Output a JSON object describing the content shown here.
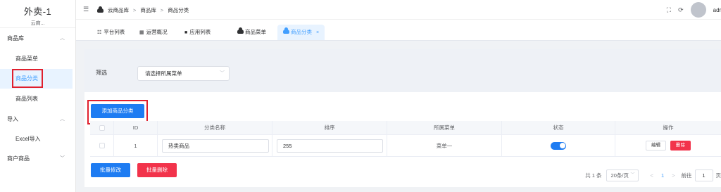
{
  "sidebar": {
    "brand_title": "外卖-1",
    "brand_sub": "云商...",
    "groups": [
      {
        "label": "商品库",
        "items": [
          "商品菜单",
          "商品分类",
          "商品列表"
        ]
      },
      {
        "label": "导入",
        "items": [
          "Excel导入"
        ]
      },
      {
        "label": "商户商品",
        "items": []
      }
    ],
    "active_item": "商品分类"
  },
  "header": {
    "breadcrumb": [
      "云商品库",
      "商品库",
      "商品分类"
    ],
    "breadcrumb_sep": ">",
    "user": "admi"
  },
  "tabs": [
    {
      "label": "平台列表",
      "icon": "list-icon"
    },
    {
      "label": "运营概况",
      "icon": "grid-icon"
    },
    {
      "label": "应用列表",
      "icon": "apps-icon"
    },
    {
      "label": "商品菜单",
      "icon": "cloud-icon"
    },
    {
      "label": "商品分类",
      "icon": "cloud-icon",
      "active": true,
      "close": "×"
    }
  ],
  "filter": {
    "label": "筛选",
    "select_placeholder": "请选择所属菜单"
  },
  "actions": {
    "add_category": "添加商品分类",
    "batch_edit": "批量修改",
    "batch_delete": "批量删除"
  },
  "table": {
    "columns": [
      "ID",
      "分类名称",
      "排序",
      "所属菜单",
      "状态",
      "操作"
    ],
    "rows": [
      {
        "id": "1",
        "name": "热卖商品",
        "sort": "255",
        "menu": "菜单一",
        "status_on": true,
        "edit": "编辑",
        "delete": "删除"
      }
    ]
  },
  "pagination": {
    "total": "共 1 条",
    "page_size": "20条/页",
    "prev": "<",
    "current": "1",
    "next": ">",
    "goto_label": "前往",
    "goto_value": "1",
    "page_suffix": "页"
  },
  "colors": {
    "primary": "#1e7cf2",
    "danger": "#f2334b",
    "highlight_box": "#e0202e",
    "active_bg": "#e8f3ff"
  }
}
